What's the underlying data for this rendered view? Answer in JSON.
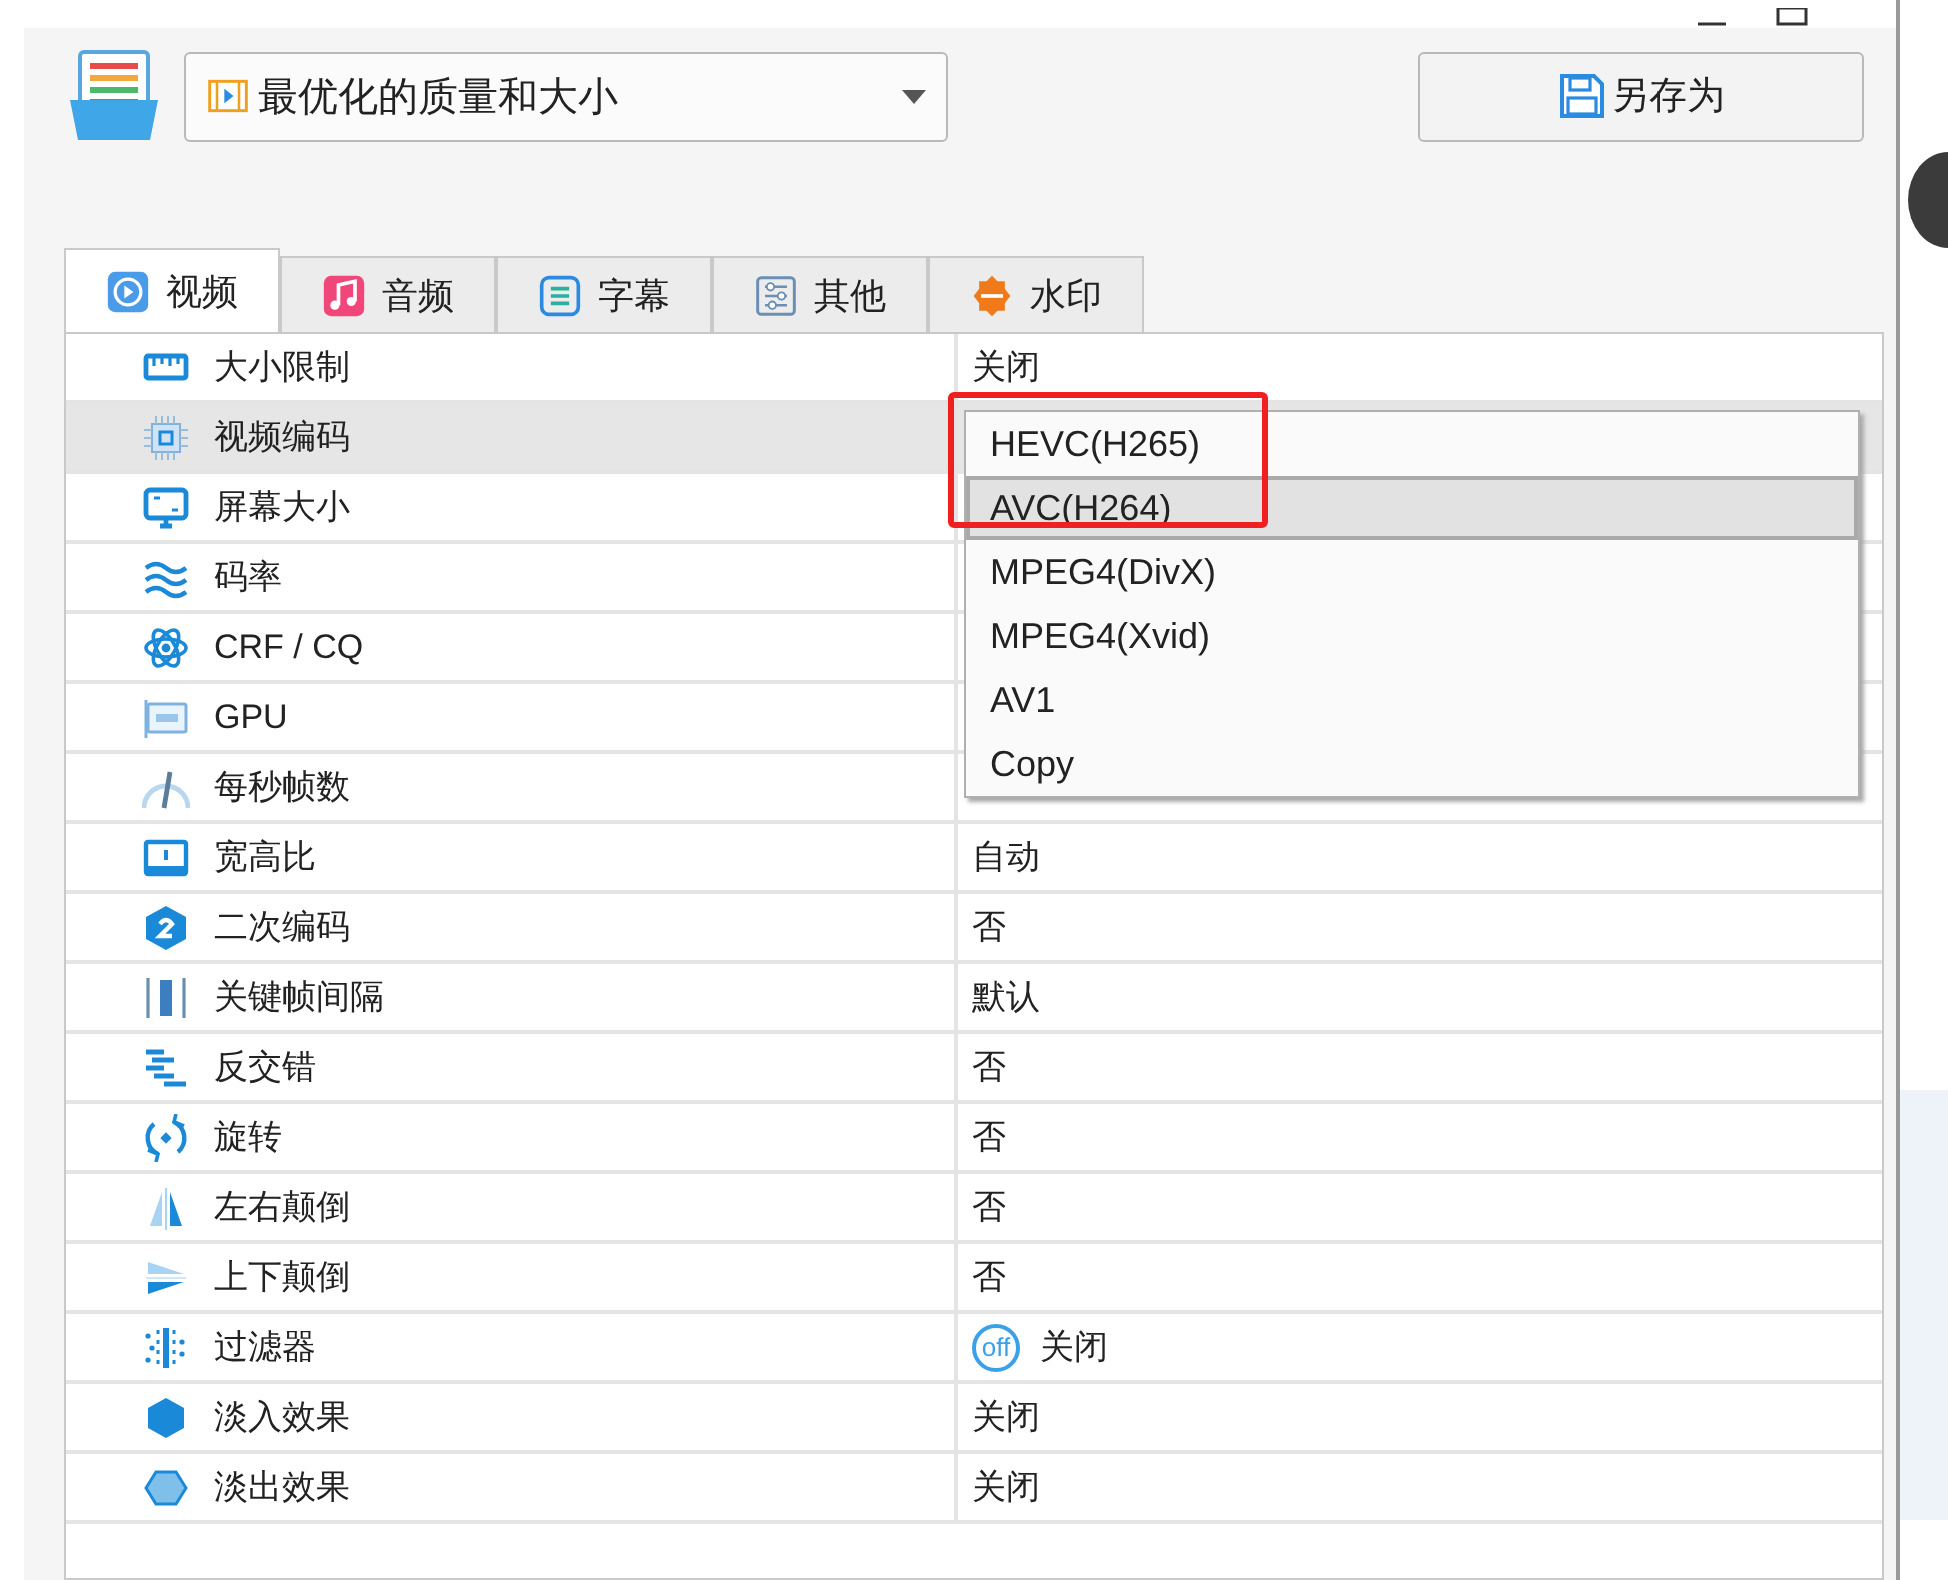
{
  "preset": {
    "value": "最优化的质量和大小"
  },
  "save_button": {
    "label": "另存为"
  },
  "tabs": [
    {
      "label": "视频",
      "selected": true
    },
    {
      "label": "音频",
      "selected": false
    },
    {
      "label": "字幕",
      "selected": false
    },
    {
      "label": "其他",
      "selected": false
    },
    {
      "label": "水印",
      "selected": false
    }
  ],
  "properties": [
    {
      "name": "大小限制",
      "value": "关闭",
      "selected": false
    },
    {
      "name": "视频编码",
      "selected": true
    },
    {
      "name": "屏幕大小",
      "selected": false
    },
    {
      "name": "码率",
      "selected": false
    },
    {
      "name": "CRF / CQ",
      "selected": false
    },
    {
      "name": "GPU",
      "selected": false
    },
    {
      "name": "每秒帧数",
      "selected": false
    },
    {
      "name": "宽高比",
      "value": "自动",
      "selected": false
    },
    {
      "name": "二次编码",
      "value": "否",
      "selected": false
    },
    {
      "name": "关键帧间隔",
      "value": "默认",
      "selected": false
    },
    {
      "name": "反交错",
      "value": "否",
      "selected": false
    },
    {
      "name": "旋转",
      "value": "否",
      "selected": false
    },
    {
      "name": "左右颠倒",
      "value": "否",
      "selected": false
    },
    {
      "name": "上下颠倒",
      "value": "否",
      "selected": false
    },
    {
      "name": "过滤器",
      "value": "关闭",
      "badge": "off",
      "selected": false
    },
    {
      "name": "淡入效果",
      "value": "关闭",
      "selected": false
    },
    {
      "name": "淡出效果",
      "value": "关闭",
      "selected": false
    }
  ],
  "codec_dropdown": {
    "items": [
      {
        "label": "HEVC(H265)",
        "selected": false
      },
      {
        "label": "AVC(H264)",
        "selected": true
      },
      {
        "label": "MPEG4(DivX)",
        "selected": false
      },
      {
        "label": "MPEG4(Xvid)",
        "selected": false
      },
      {
        "label": "AV1",
        "selected": false
      },
      {
        "label": "Copy",
        "selected": false
      }
    ],
    "highlighted": true
  }
}
